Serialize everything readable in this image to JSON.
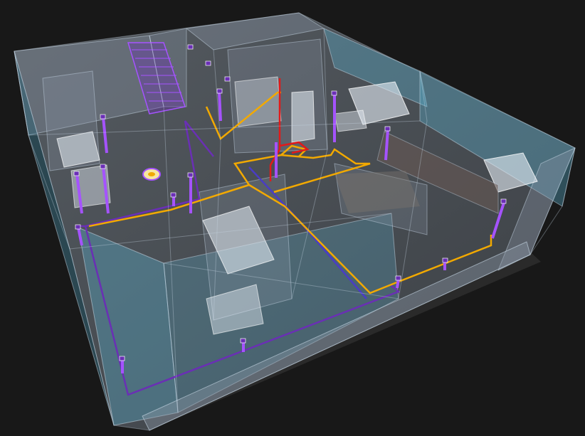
{
  "viewport": {
    "view_mode": "3d-xray",
    "background": "#181818"
  },
  "model": {
    "subject": "floor-plan-mep-routing",
    "colors": {
      "glass_blue": "#5bb7d6",
      "glass_grey": "#8b98a8",
      "edge": "#c8d8e6",
      "floor": "#3f4348",
      "floor_shadow": "#2a2a2a",
      "fixture": "#e6eef6",
      "kitchen_counter": "#6a5a54"
    }
  },
  "systems": [
    {
      "name": "hot-water-line",
      "color": "#e11a1a"
    },
    {
      "name": "cold-water-line",
      "color": "#f2a900"
    },
    {
      "name": "drain-line",
      "color": "#6a2fb5"
    },
    {
      "name": "riser-pipes",
      "color": "#a553ff"
    }
  ],
  "icons": {
    "floor-drain": "circular-drain-icon"
  }
}
